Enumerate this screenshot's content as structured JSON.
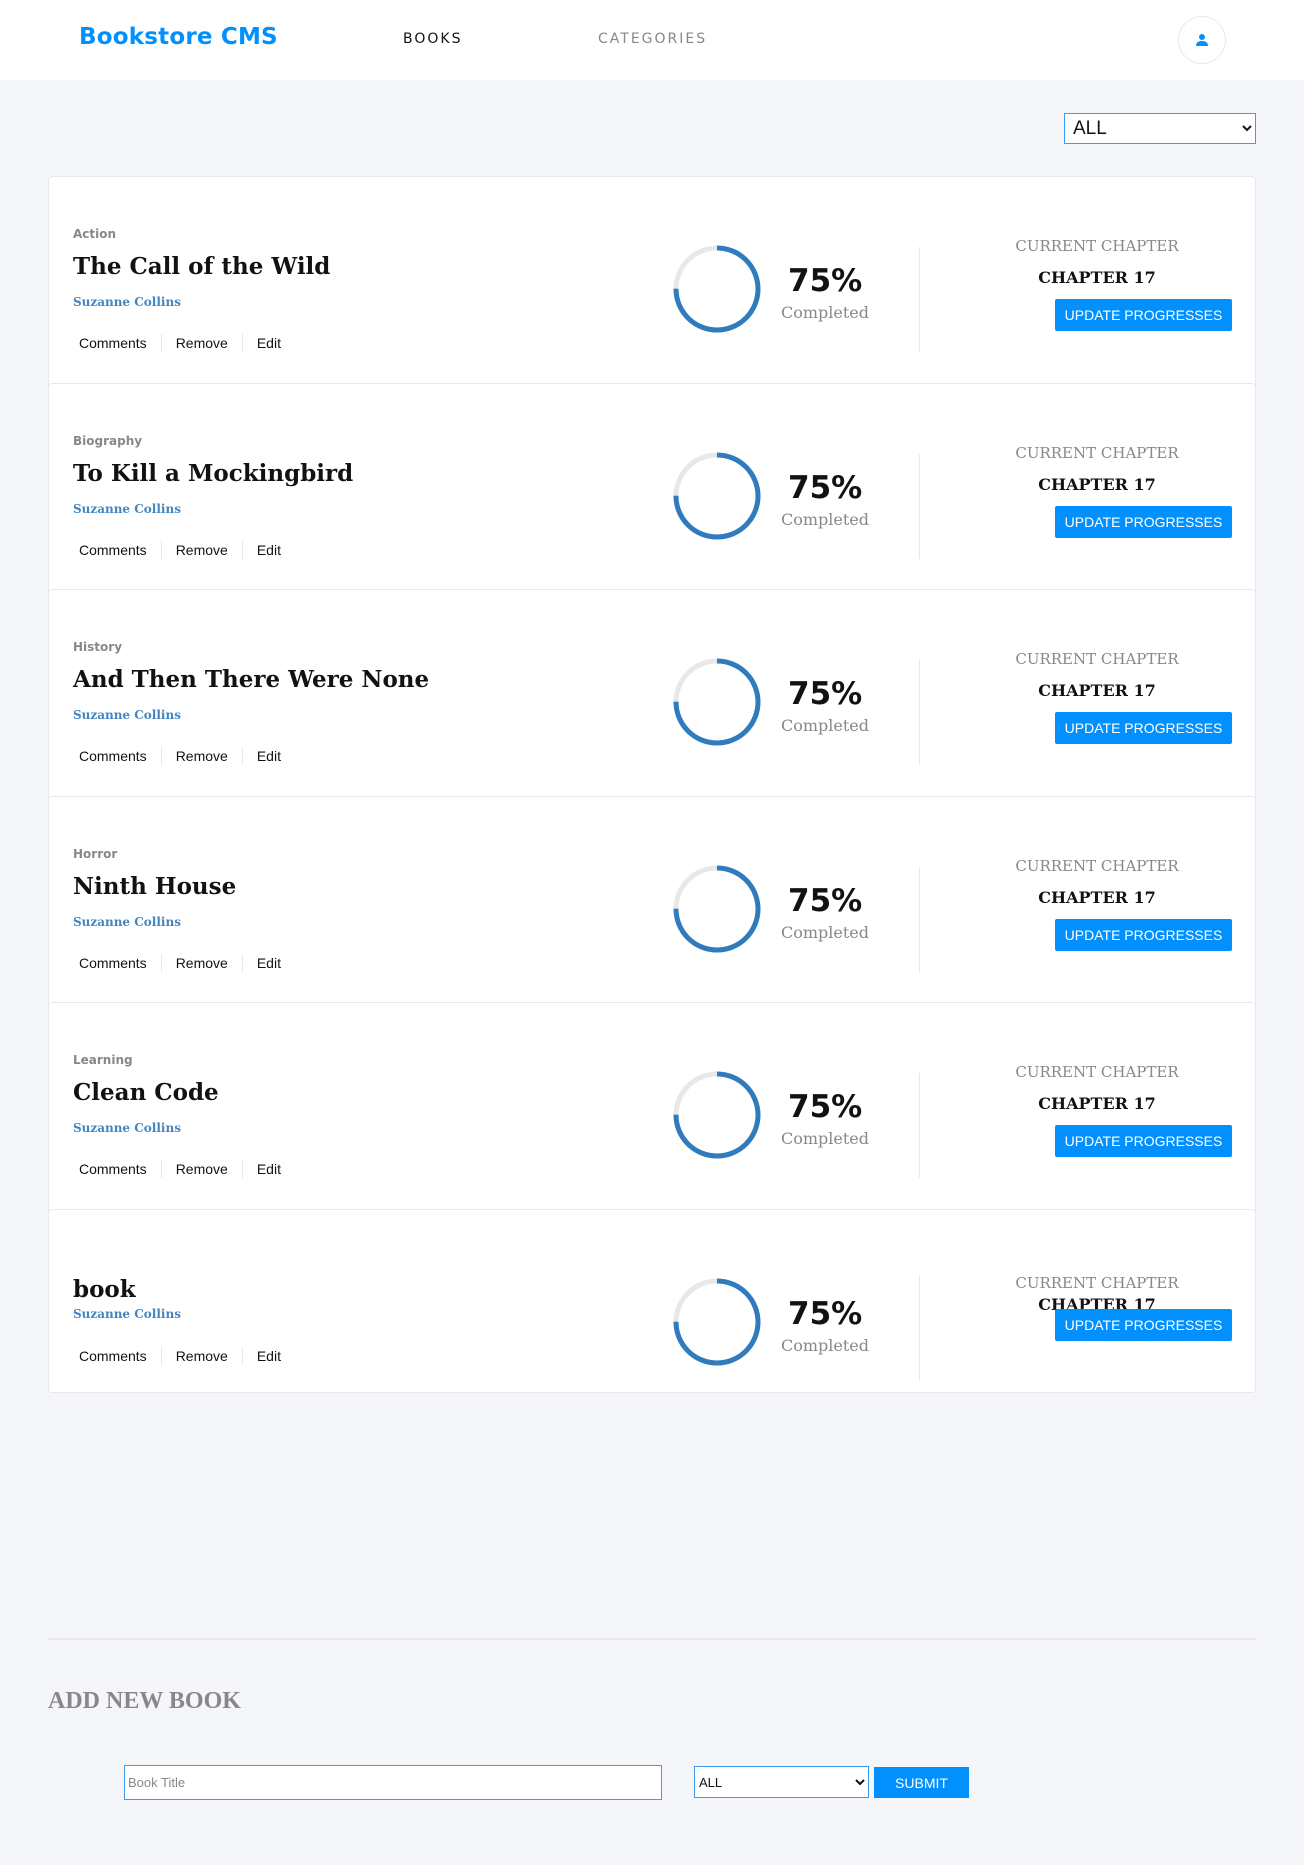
{
  "header": {
    "brand": "Bookstore CMS",
    "nav": [
      {
        "label": "BOOKS"
      },
      {
        "label": "CATEGORIES"
      }
    ],
    "user_icon": "user-icon"
  },
  "filter": {
    "selected": "ALL"
  },
  "labels": {
    "comments": "Comments",
    "remove": "Remove",
    "edit": "Edit",
    "completed": "Completed",
    "current_chapter": "CURRENT CHAPTER",
    "update_button": "UPDATE PROGRESSES"
  },
  "books": [
    {
      "genre": "Action",
      "title": "The Call of the Wild",
      "author": "Suzanne Collins",
      "progress": 75,
      "percent_text": "75%",
      "chapter": "CHAPTER 17"
    },
    {
      "genre": "Biography",
      "title": "To Kill a Mockingbird",
      "author": "Suzanne Collins",
      "progress": 75,
      "percent_text": "75%",
      "chapter": "CHAPTER 17"
    },
    {
      "genre": "History",
      "title": "And Then There Were None",
      "author": "Suzanne Collins",
      "progress": 75,
      "percent_text": "75%",
      "chapter": "CHAPTER 17"
    },
    {
      "genre": "Horror",
      "title": "Ninth House",
      "author": "Suzanne Collins",
      "progress": 75,
      "percent_text": "75%",
      "chapter": "CHAPTER 17"
    },
    {
      "genre": "Learning",
      "title": "Clean Code",
      "author": "Suzanne Collins",
      "progress": 75,
      "percent_text": "75%",
      "chapter": "CHAPTER 17"
    },
    {
      "genre": "",
      "title": "book",
      "author": "Suzanne Collins",
      "progress": 75,
      "percent_text": "75%",
      "chapter": "CHAPTER 17"
    }
  ],
  "add_form": {
    "heading": "ADD NEW BOOK",
    "title_placeholder": "Book Title",
    "category_selected": "ALL",
    "submit_label": "SUBMIT"
  },
  "colors": {
    "accent": "#0290ff",
    "author": "#4386bf",
    "ring_fill": "#307bbe",
    "ring_track": "#e8e8e8"
  }
}
